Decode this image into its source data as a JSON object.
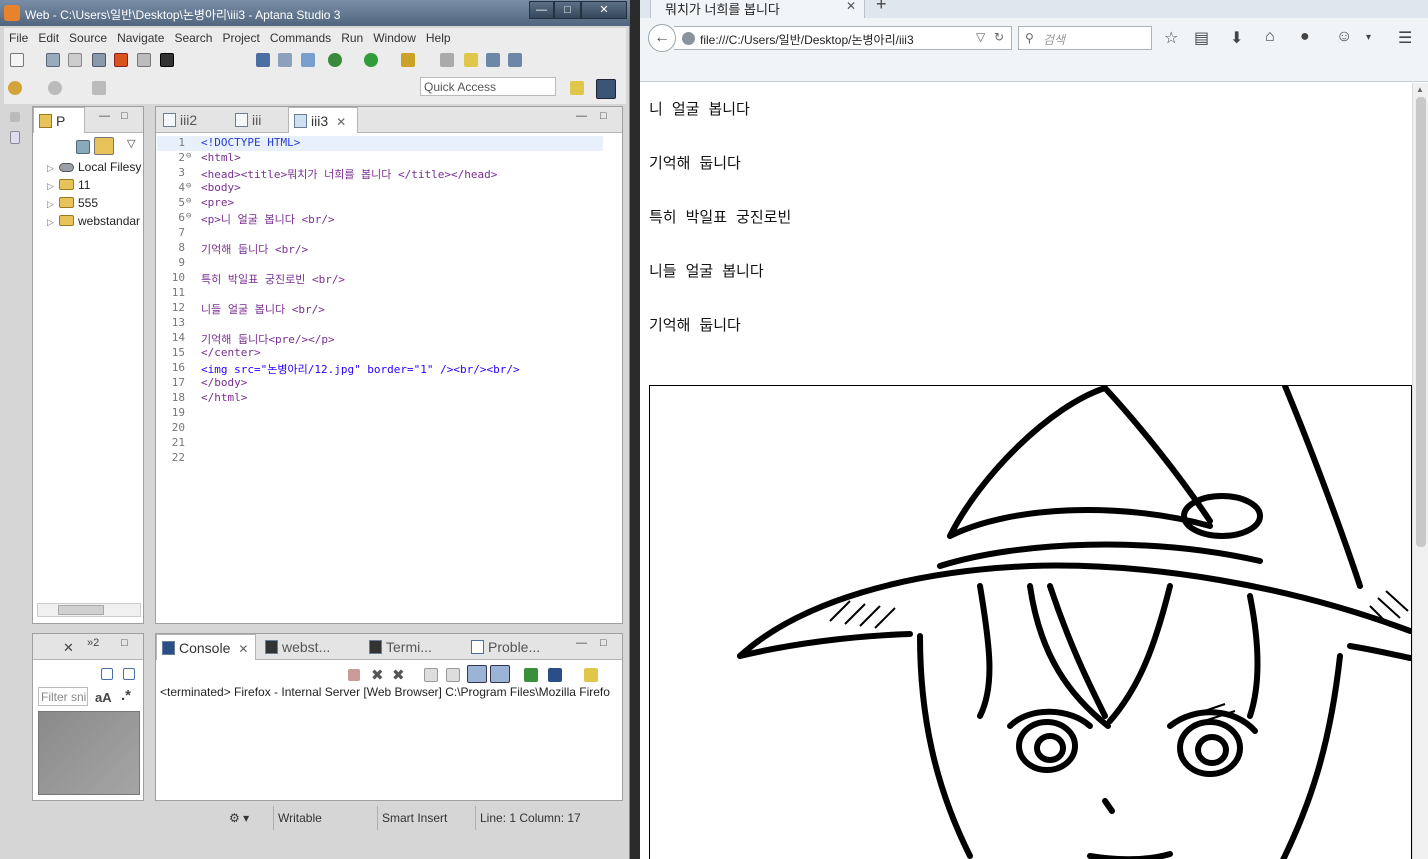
{
  "ide": {
    "window_title": "Web - C:\\Users\\일반\\Desktop\\논병아리\\iii3 - Aptana Studio 3",
    "window_controls": [
      "—",
      "□",
      "✕"
    ],
    "menu": [
      "File",
      "Edit",
      "Source",
      "Navigate",
      "Search",
      "Project",
      "Commands",
      "Run",
      "Window",
      "Help"
    ],
    "quick_access": "Quick Access",
    "project_panel": {
      "tab_label": "P",
      "items": [
        {
          "label": "Local Filesy",
          "icon": "disk-icon"
        },
        {
          "label": "11",
          "icon": "project-folder-icon"
        },
        {
          "label": "555",
          "icon": "project-folder-icon"
        },
        {
          "label": "webstandar",
          "icon": "project-folder-icon"
        }
      ]
    },
    "editor_tabs": [
      {
        "label": "iii2",
        "active": false
      },
      {
        "label": "iii",
        "active": false
      },
      {
        "label": "iii3",
        "active": true
      }
    ],
    "editor_tab_close": "✕",
    "code_lines": [
      {
        "n": "1",
        "fold": "",
        "text": "<!DOCTYPE HTML>"
      },
      {
        "n": "2",
        "fold": "⊖",
        "text": "<html>"
      },
      {
        "n": "3",
        "fold": "",
        "text": "<head><title>뭐치가 너희를 봅니다 </title></head>"
      },
      {
        "n": "4",
        "fold": "⊖",
        "text": "<body>"
      },
      {
        "n": "5",
        "fold": "⊖",
        "text": "<pre>"
      },
      {
        "n": "6",
        "fold": "⊖",
        "text": "<p>니 얼굴 봅니다 <br/>"
      },
      {
        "n": "7",
        "fold": "",
        "text": ""
      },
      {
        "n": "8",
        "fold": "",
        "text": "기억해 둡니다 <br/>"
      },
      {
        "n": "9",
        "fold": "",
        "text": ""
      },
      {
        "n": "10",
        "fold": "",
        "text": "특히 박일표 궁진로빈 <br/>"
      },
      {
        "n": "11",
        "fold": "",
        "text": ""
      },
      {
        "n": "12",
        "fold": "",
        "text": "니들 얼굴 봅니다 <br/>"
      },
      {
        "n": "13",
        "fold": "",
        "text": ""
      },
      {
        "n": "14",
        "fold": "",
        "text": "기억해 둡니다<pre/></p>"
      },
      {
        "n": "15",
        "fold": "",
        "text": "</center>"
      },
      {
        "n": "16",
        "fold": "",
        "text": "<img src=\"논병아리/12.jpg\" border=\"1\" /><br/><br/>"
      },
      {
        "n": "17",
        "fold": "",
        "text": "</body>"
      },
      {
        "n": "18",
        "fold": "",
        "text": "</html>"
      },
      {
        "n": "19",
        "fold": "",
        "text": ""
      },
      {
        "n": "20",
        "fold": "",
        "text": ""
      },
      {
        "n": "21",
        "fold": "",
        "text": ""
      },
      {
        "n": "22",
        "fold": "",
        "text": ""
      }
    ],
    "snippets_panel": {
      "tab_count": "»2",
      "filter_placeholder": "Filter sni",
      "case_label": "aA",
      "regex_label": ".*"
    },
    "bottom_tabs": [
      {
        "label": "Console",
        "active": true
      },
      {
        "label": "webst...",
        "active": false
      },
      {
        "label": "Termi...",
        "active": false
      },
      {
        "label": "Proble...",
        "active": false
      }
    ],
    "console_text": "<terminated> Firefox - Internal Server [Web Browser] C:\\Program Files\\Mozilla Firefo",
    "status": {
      "writable": "Writable",
      "insert_mode": "Smart Insert",
      "position": "Line: 1 Column: 17"
    }
  },
  "browser": {
    "tab_title": "뭐치가 너희를 봅니다",
    "tab_close": "✕",
    "new_tab": "+",
    "url": "file:///C:/Users/일반/Desktop/논병아리/iii3",
    "search_placeholder": "검색",
    "page_lines": [
      "니 얼굴 봅니다",
      "기억해 둡니다",
      "특히 박일표 궁진로빈",
      "니들 얼굴 봅니다",
      "기억해 둡니다"
    ]
  },
  "colors": {
    "ide_bg": "#d6d6d6",
    "title_bar": "#51657f",
    "code_tag": "#7a2f91",
    "code_string": "#2a00ff",
    "browser_toolbar": "#f1f4f7"
  }
}
